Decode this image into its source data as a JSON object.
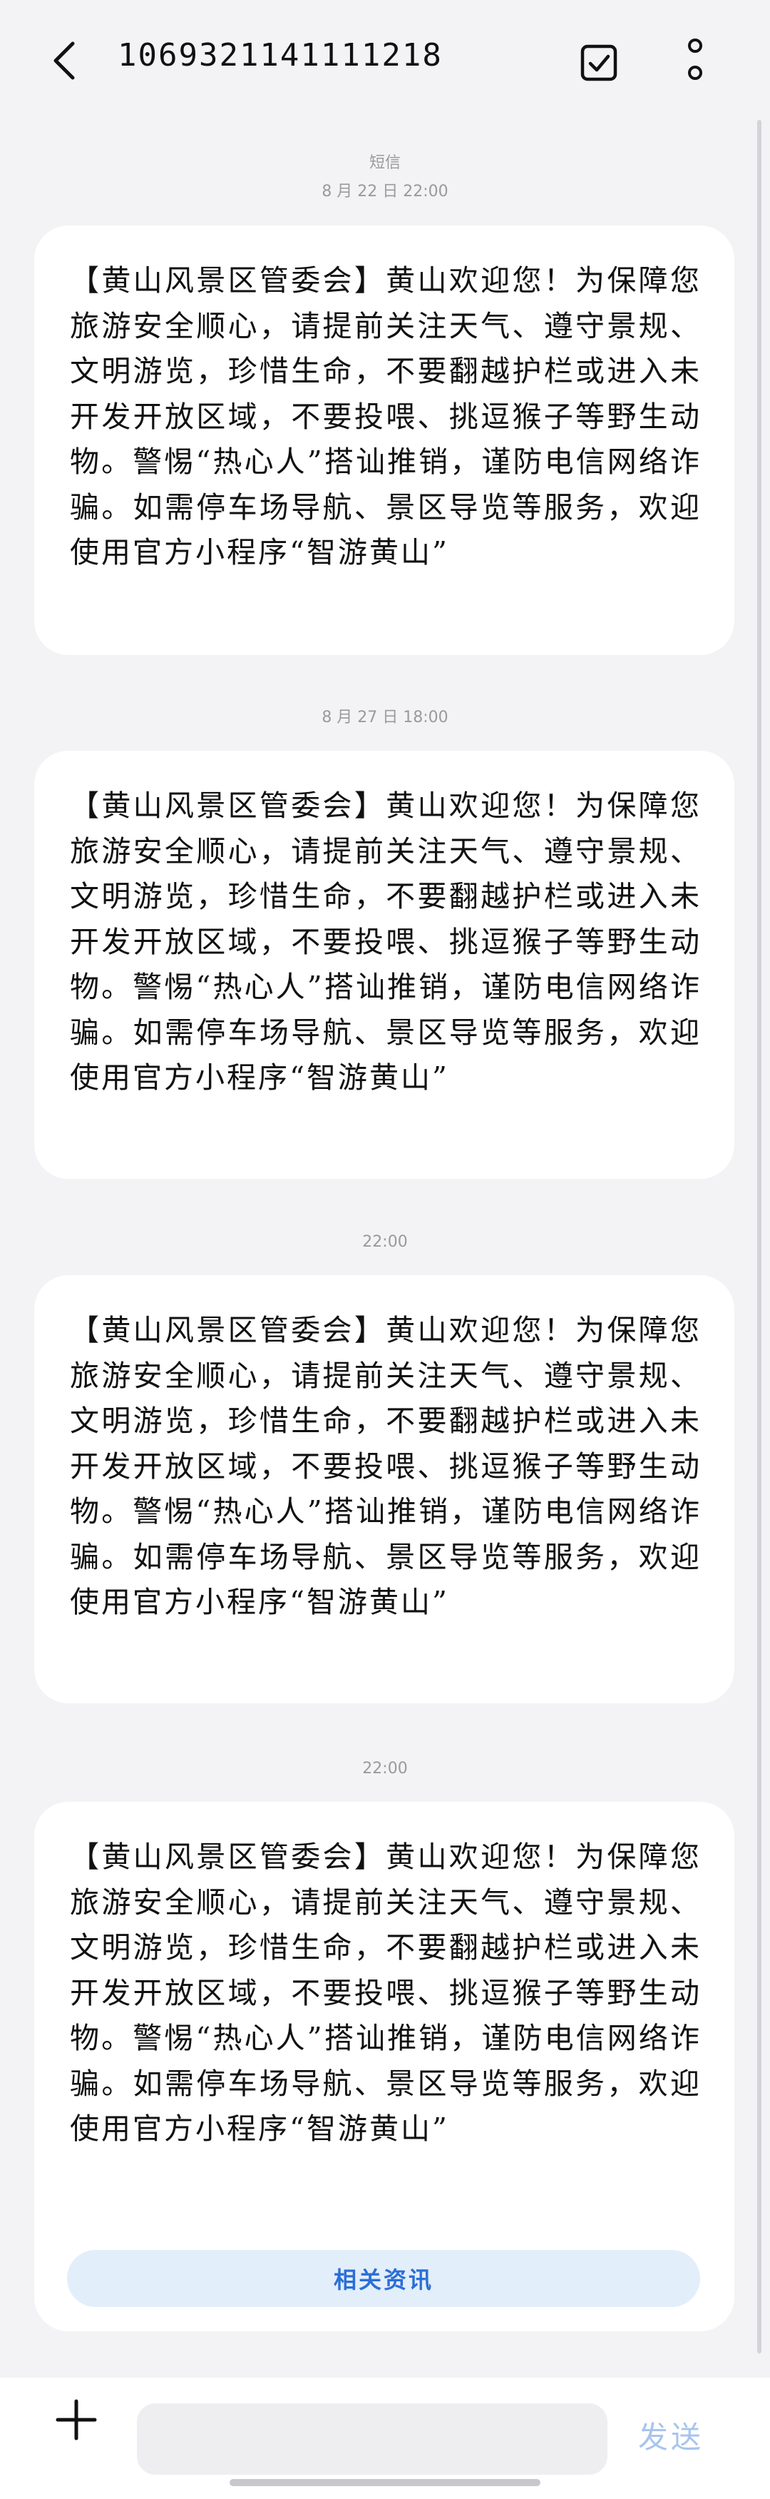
{
  "header": {
    "title": "1069321141111218",
    "back_icon": "chevron-left-icon",
    "select_icon": "checkbox-icon",
    "more_icon": "more-vertical-icon"
  },
  "thread": {
    "channel_label": "短信",
    "items": [
      {
        "timestamp": "8 月 22 日 22:00",
        "text": "【黄山风景区管委会】黄山欢迎您！为保障您旅游安全顺心，请提前关注天气、遵守景规、文明游览，珍惜生命，不要翻越护栏或进入未开发开放区域，不要投喂、挑逗猴子等野生动物。警惕“热心人”搭讪推销，谨防电信网络诈骗。如需停车场导航、景区导览等服务，欢迎使用官方小程序“智游黄山”"
      },
      {
        "timestamp": "8 月 27 日 18:00",
        "text": "【黄山风景区管委会】黄山欢迎您！为保障您旅游安全顺心，请提前关注天气、遵守景规、文明游览，珍惜生命，不要翻越护栏或进入未开发开放区域，不要投喂、挑逗猴子等野生动物。警惕“热心人”搭讪推销，谨防电信网络诈骗。如需停车场导航、景区导览等服务，欢迎使用官方小程序“智游黄山”"
      },
      {
        "timestamp": "22:00",
        "text": "【黄山风景区管委会】黄山欢迎您！为保障您旅游安全顺心，请提前关注天气、遵守景规、文明游览，珍惜生命，不要翻越护栏或进入未开发开放区域，不要投喂、挑逗猴子等野生动物。警惕“热心人”搭讪推销，谨防电信网络诈骗。如需停车场导航、景区导览等服务，欢迎使用官方小程序“智游黄山”"
      },
      {
        "timestamp": "22:00",
        "text": "【黄山风景区管委会】黄山欢迎您！为保障您旅游安全顺心，请提前关注天气、遵守景规、文明游览，珍惜生命，不要翻越护栏或进入未开发开放区域，不要投喂、挑逗猴子等野生动物。警惕“热心人”搭讪推销，谨防电信网络诈骗。如需停车场导航、景区导览等服务，欢迎使用官方小程序“智游黄山”",
        "related_label": "相关资讯"
      }
    ]
  },
  "compose": {
    "add_icon": "plus-icon",
    "input_value": "",
    "input_placeholder": "",
    "send_label": "发送"
  },
  "colors": {
    "background": "#f3f3f5",
    "bubble": "#ffffff",
    "accent": "#2a6fd6",
    "send_disabled": "#a7c4ee"
  }
}
